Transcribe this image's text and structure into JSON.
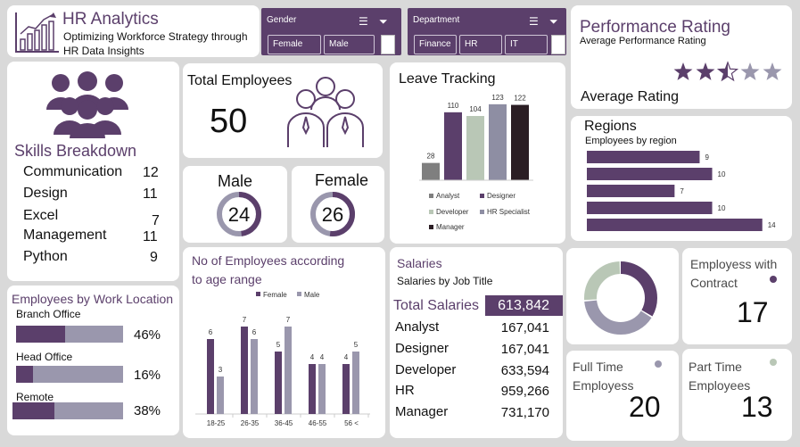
{
  "header": {
    "title": "HR Analytics",
    "subtitle_line1": "Optimizing Workforce Strategy through",
    "subtitle_line2": "HR Data Insights"
  },
  "gender_slicer": {
    "title": "Gender",
    "options": [
      "Female",
      "Male"
    ]
  },
  "department_slicer": {
    "title": "Department",
    "options": [
      "Finance",
      "HR",
      "IT"
    ]
  },
  "performance": {
    "title": "Performance Rating",
    "subtitle": "Average Performance Rating",
    "rating": 2.5,
    "max": 5,
    "label": "Average Rating"
  },
  "skills": {
    "title": "Skills Breakdown",
    "items": [
      {
        "name": "Communication",
        "count": "12"
      },
      {
        "name": "Design",
        "count": "11"
      },
      {
        "name": "Excel",
        "count": "7"
      },
      {
        "name": "Management",
        "count": "11"
      },
      {
        "name": "Python",
        "count": "9"
      }
    ]
  },
  "total_employees": {
    "label": "Total Employees",
    "value": "50"
  },
  "gender_counts": {
    "male": {
      "label": "Male",
      "value": "24",
      "fraction": 0.48
    },
    "female": {
      "label": "Female",
      "value": "26",
      "fraction": 0.52
    }
  },
  "leave_chart": {
    "title": "Leave Tracking",
    "chart_data": {
      "type": "bar",
      "categories": [
        "Analyst",
        "Designer",
        "Developer",
        "HR Specialist",
        "Manager"
      ],
      "values": [
        28,
        110,
        104,
        123,
        122
      ],
      "ylim": [
        0,
        130
      ]
    },
    "colors": [
      "#7f7f7f",
      "#5b3f6b",
      "#b9c7b6",
      "#8e8ea3",
      "#2b1e24"
    ]
  },
  "regions": {
    "title": "Regions",
    "subtitle": "Employees by region",
    "chart_data": {
      "type": "bar",
      "values": [
        9,
        10,
        7,
        10,
        14
      ],
      "xlim": [
        0,
        15
      ]
    }
  },
  "work_location": {
    "title": "Employees by Work Location",
    "items": [
      {
        "name": "Branch Office",
        "pct": "46%",
        "fraction": 0.46
      },
      {
        "name": "Head Office",
        "pct": "16%",
        "fraction": 0.16
      },
      {
        "name": "Remote",
        "pct": "38%",
        "fraction": 0.38
      }
    ]
  },
  "age_chart": {
    "title_line1": "No of Employees according",
    "title_line2": "to age range",
    "chart_data": {
      "type": "bar",
      "categories": [
        "18-25",
        "26-35",
        "36-45",
        "46-55",
        "56 <"
      ],
      "series": [
        {
          "name": "Female",
          "values": [
            6,
            7,
            5,
            4,
            4
          ],
          "color": "#5b3f6b"
        },
        {
          "name": "Male",
          "values": [
            3,
            6,
            7,
            4,
            5
          ],
          "color": "#9a97ad"
        }
      ],
      "ylim": [
        0,
        8
      ]
    }
  },
  "salaries": {
    "title": "Salaries",
    "subtitle": "Salaries by Job Title",
    "total_label": "Total Salaries",
    "total_value": "613,842",
    "rows": [
      {
        "name": "Analyst",
        "value": "167,041"
      },
      {
        "name": "Designer",
        "value": "167,041"
      },
      {
        "name": "Developer",
        "value": "633,594"
      },
      {
        "name": "HR",
        "value": "959,266"
      },
      {
        "name": "Manager",
        "value": "731,170"
      }
    ]
  },
  "contract_donut": {
    "chart_data": {
      "type": "pie",
      "values": [
        17,
        20,
        13
      ]
    },
    "colors": [
      "#5b3f6b",
      "#9a97ad",
      "#b9c7b6"
    ]
  },
  "contract": {
    "label_line1": "Employess with",
    "label_line2": "Contract",
    "value": "17",
    "dot_color": "#5b3f6b"
  },
  "full_time": {
    "label_line1": "Full Time",
    "label_line2": "Employess",
    "value": "20",
    "dot_color": "#9a97ad"
  },
  "part_time": {
    "label_line1": "Part Time",
    "label_line2": "Employees",
    "value": "13",
    "dot_color": "#b9c7b6"
  }
}
